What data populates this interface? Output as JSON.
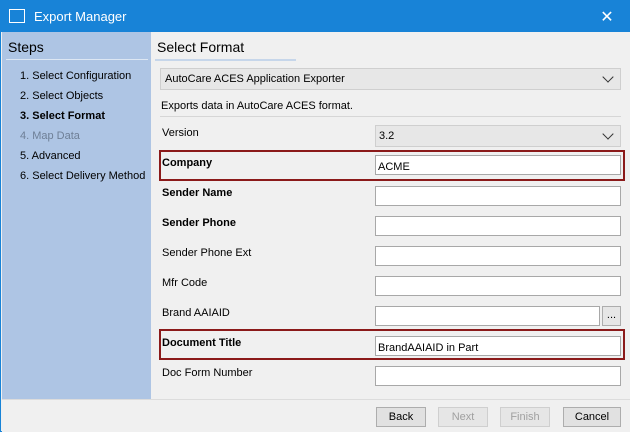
{
  "window": {
    "title": "Export Manager",
    "close_label": "✕"
  },
  "sidebar": {
    "title": "Steps",
    "steps": [
      {
        "label": "1. Select Configuration",
        "state": "normal"
      },
      {
        "label": "2. Select Objects",
        "state": "normal"
      },
      {
        "label": "3. Select Format",
        "state": "active"
      },
      {
        "label": "4. Map Data",
        "state": "disabled"
      },
      {
        "label": "5. Advanced",
        "state": "normal"
      },
      {
        "label": "6. Select Delivery Method",
        "state": "normal"
      }
    ]
  },
  "main": {
    "title": "Select Format",
    "format_select": "AutoCare ACES Application Exporter",
    "description": "Exports data in AutoCare ACES format.",
    "fields": {
      "version": {
        "label": "Version",
        "value": "3.2"
      },
      "company": {
        "label": "Company",
        "value": "ACME"
      },
      "sender_name": {
        "label": "Sender Name",
        "value": ""
      },
      "sender_phone": {
        "label": "Sender Phone",
        "value": ""
      },
      "sender_phone_ext": {
        "label": "Sender Phone Ext",
        "value": ""
      },
      "mfr_code": {
        "label": "Mfr Code",
        "value": ""
      },
      "brand_aaiaid": {
        "label": "Brand AAIAID",
        "value": "",
        "browse_label": "..."
      },
      "document_title": {
        "label": "Document Title",
        "value": "BrandAAIAID in Part"
      },
      "doc_form_number": {
        "label": "Doc Form Number",
        "value": ""
      }
    }
  },
  "footer": {
    "back": "Back",
    "next": "Next",
    "finish": "Finish",
    "cancel": "Cancel"
  },
  "colors": {
    "titlebar": "#1883d7",
    "sidebar": "#aec5e4",
    "highlight": "#8b1a1a"
  }
}
